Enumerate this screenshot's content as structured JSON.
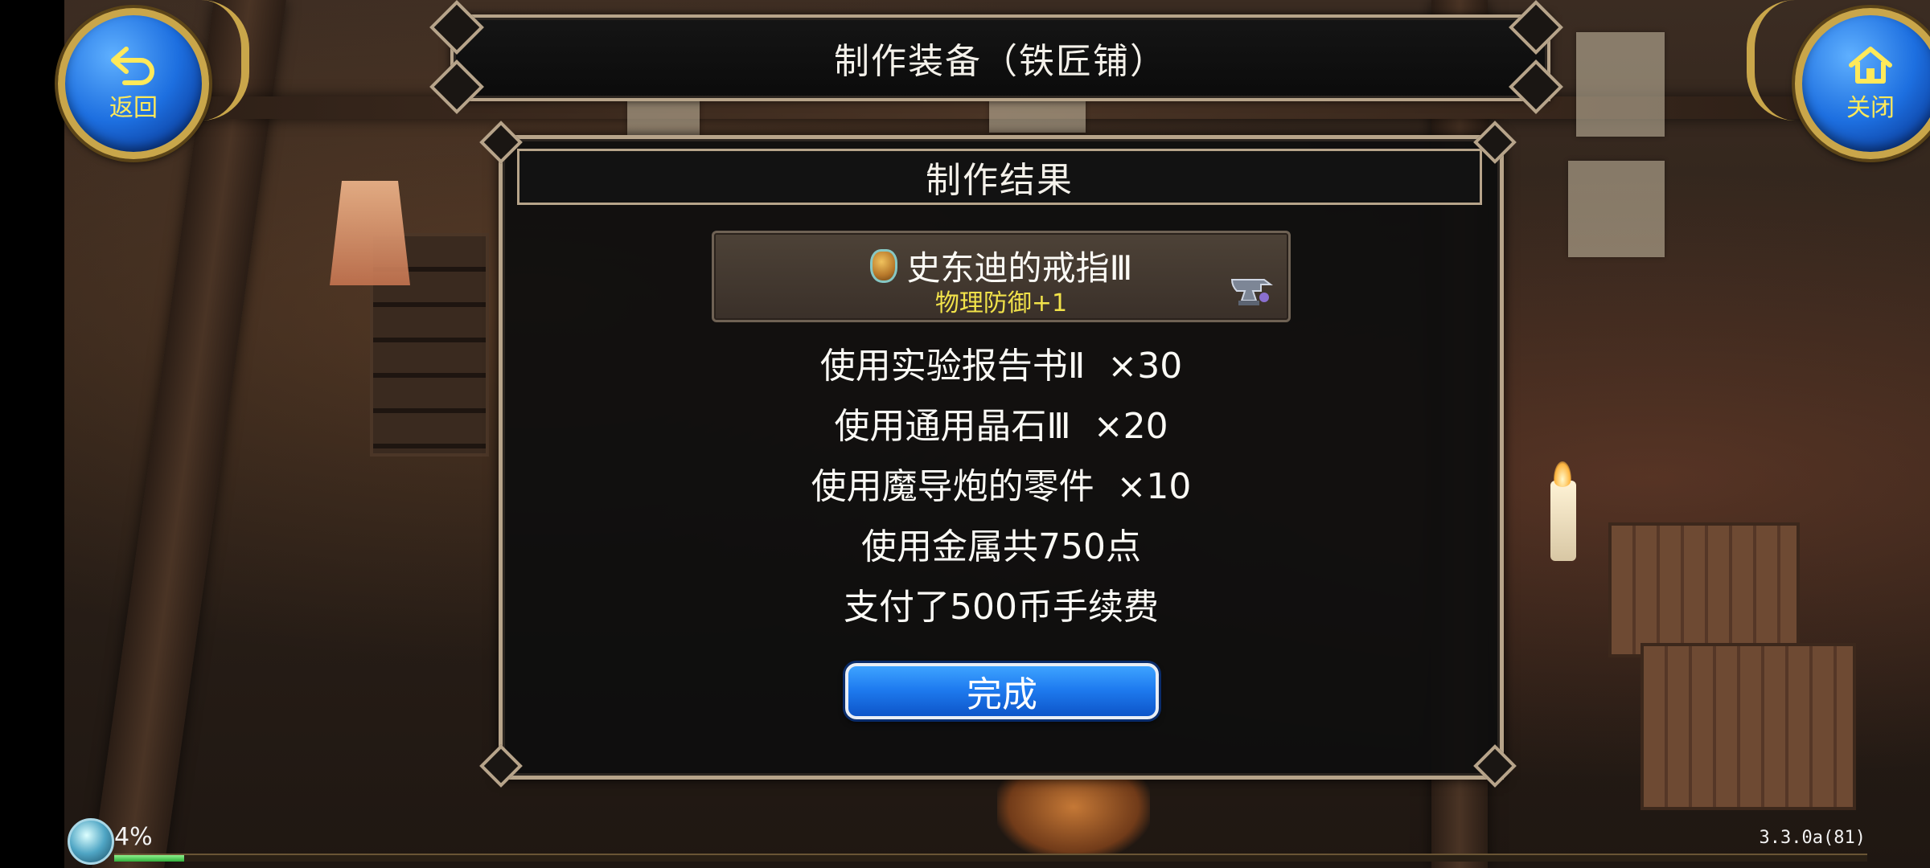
{
  "header": {
    "title": "制作装备（铁匠铺）",
    "back_label": "返回",
    "close_label": "关闭"
  },
  "panel": {
    "title": "制作结果",
    "item": {
      "name": "史东迪的戒指Ⅲ",
      "bonus": "物理防御+1",
      "icon": "ring-icon",
      "badge_icon": "anvil-icon"
    },
    "lines": [
      "使用实验报告书Ⅱ  ×30",
      "使用通用晶石Ⅲ  ×20",
      "使用魔导炮的零件  ×10",
      "使用金属共750点",
      "支付了500币手续费"
    ],
    "done_label": "完成"
  },
  "status": {
    "exp_percent_label": "4%",
    "exp_fraction": 0.04,
    "version": "3.3.0a(81)"
  },
  "colors": {
    "button_blue": "#1f7cf0",
    "bonus_yellow": "#f1e24a",
    "frame_gold": "#c9a64a"
  }
}
